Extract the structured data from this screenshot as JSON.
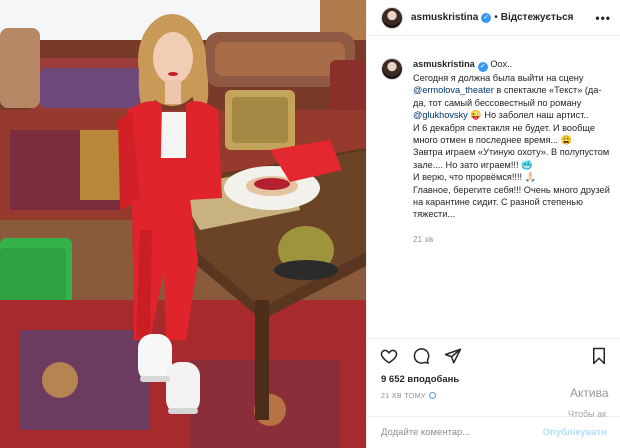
{
  "post": {
    "username": "asmuskristina",
    "follow_label": "Відстежується",
    "more_label": "•••",
    "caption_username": "asmuskristina",
    "caption_lines": [
      " Оох..",
      "Сегодня я должна была выйти на сцену ",
      " в спектакле «Текст» (да-да, тот самый бессовестный по роману ",
      " 😜 Но заболел наш артист..",
      "И 6 декабря спектакля не будет. И вообще много отмен в последнее время... 😩",
      "Завтра играем «Утиную охоту». В полупустом зале.... Но зато играем!!! 🥶",
      "И верю, что прорвёмся!!!! 🙏🏻",
      "Главное, берегите себя!!! Очень много друзей на карантине сидит. С разной степенью тяжести..."
    ],
    "mention_theater": "@ermolova_theater",
    "mention_author": "@glukhovsky",
    "caption_time": "21 хв",
    "likes": "9 652 вподобань",
    "posted_ago": "21 ХВ ТОМУ",
    "comment_placeholder": "Додайте коментар...",
    "publish_label": "Опублікувати"
  },
  "icons": {
    "like": "heart-icon",
    "comment": "comment-icon",
    "share": "share-icon",
    "save": "bookmark-icon",
    "verified": "verified-badge-icon"
  },
  "overlay": {
    "activate_title": "Актива",
    "activate_sub": "Чтобы ак"
  },
  "colors": {
    "verified": "#3897f0",
    "mention": "#00376b",
    "publish_disabled": "#b2dffc",
    "muted": "#8e8e8e"
  }
}
